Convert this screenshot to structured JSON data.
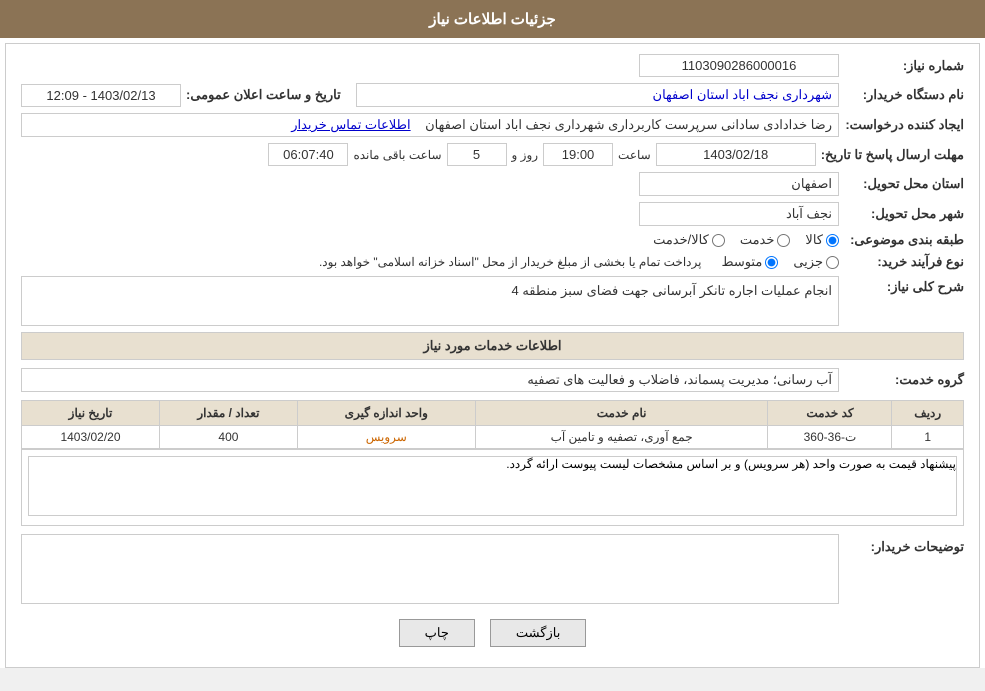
{
  "header": {
    "title": "جزئیات اطلاعات نیاز"
  },
  "form": {
    "need_number_label": "شماره نیاز:",
    "need_number_value": "1103090286000016",
    "buyer_org_label": "نام دستگاه خریدار:",
    "buyer_org_value": "شهرداری نجف اباد استان اصفهان",
    "requester_label": "ایجاد کننده درخواست:",
    "requester_value": "رضا خدادادی سادانی سرپرست  کاربرداری شهرداری نجف اباد استان اصفهان",
    "contact_link": "اطلاعات تماس خریدار",
    "date_announce_label": "تاریخ و ساعت اعلان عمومی:",
    "date_announce_value": "1403/02/13 - 12:09",
    "response_deadline_label": "مهلت ارسال پاسخ تا تاریخ:",
    "response_date": "1403/02/18",
    "response_time_label": "ساعت",
    "response_time": "19:00",
    "response_days_label": "روز و",
    "response_days": "5",
    "remaining_label": "ساعت باقی مانده",
    "remaining_time": "06:07:40",
    "province_label": "استان محل تحویل:",
    "province_value": "اصفهان",
    "city_label": "شهر محل تحویل:",
    "city_value": "نجف آباد",
    "category_label": "طبقه بندی موضوعی:",
    "category_options": [
      "کالا",
      "خدمت",
      "کالا/خدمت"
    ],
    "category_selected": "کالا",
    "purchase_type_label": "نوع فرآیند خرید:",
    "purchase_type_options": [
      "جزیی",
      "متوسط"
    ],
    "purchase_type_selected": "متوسط",
    "purchase_type_note": "پرداخت تمام یا بخشی از مبلغ خریدار از محل \"اسناد خزانه اسلامی\" خواهد بود.",
    "general_desc_label": "شرح کلی نیاز:",
    "general_desc_value": "انجام عملیات اجاره تانکر آبرسانی جهت فضای سبز منطقه 4",
    "services_info_header": "اطلاعات خدمات مورد نیاز",
    "service_group_label": "گروه خدمت:",
    "service_group_value": "آب رسانی؛ مدیریت پسماند، فاضلاب و فعالیت های تصفیه",
    "table": {
      "columns": [
        "ردیف",
        "کد خدمت",
        "نام خدمت",
        "واحد اندازه گیری",
        "تعداد / مقدار",
        "تاریخ نیاز"
      ],
      "rows": [
        {
          "row_num": "1",
          "service_code": "ت-36-360",
          "service_name": "جمع آوری، تصفیه و تامین آب",
          "unit": "سرویس",
          "quantity": "400",
          "date": "1403/02/20"
        }
      ]
    },
    "table_note": "پیشنهاد قیمت به صورت واحد (هر سرویس) و بر اساس مشخصات لیست پیوست ارائه گردد.",
    "buyer_notes_label": "توضیحات خریدار:",
    "buyer_notes_value": "پیشنهاد قیمت به صورت واحد (هر سرویس) و بر اساس مشخصات لیست پیوست ارائه گردد.",
    "buttons": {
      "print": "چاپ",
      "back": "بازگشت"
    }
  }
}
